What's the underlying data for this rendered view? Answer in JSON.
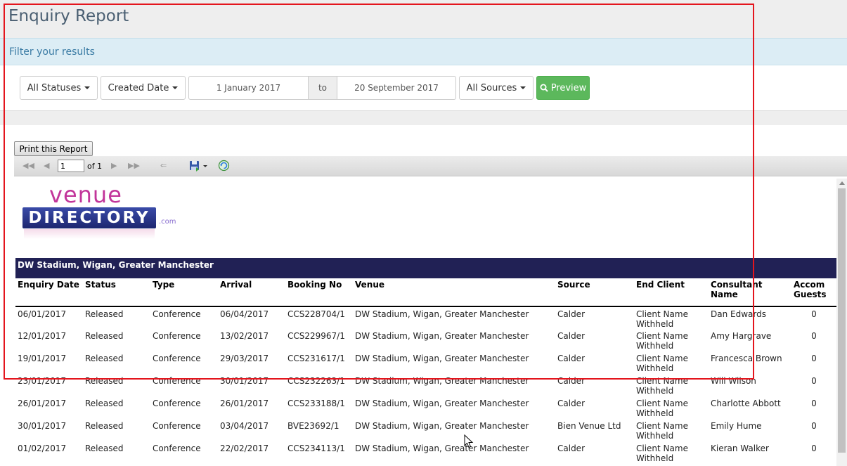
{
  "page": {
    "title": "Enquiry Report"
  },
  "filter": {
    "heading": "Filter your results",
    "status_label": "All Statuses",
    "date_type_label": "Created Date",
    "date_from": "1 January 2017",
    "date_to_label": "to",
    "date_to": "20 September 2017",
    "sources_label": "All Sources",
    "preview_label": "Preview"
  },
  "report_viewer": {
    "print_label": "Print this Report",
    "page_number": "1",
    "page_of": "of 1"
  },
  "logo": {
    "word1": "venue",
    "word2": "DIRECTORY",
    "suffix": ".com"
  },
  "report": {
    "group_title": "DW Stadium, Wigan, Greater Manchester",
    "columns": [
      "Enquiry Date",
      "Status",
      "Type",
      "Arrival",
      "Booking No",
      "Venue",
      "Source",
      "End Client",
      "Consultant Name",
      "Accom Guests"
    ],
    "rows": [
      [
        "06/01/2017",
        "Released",
        "Conference",
        "06/04/2017",
        "CCS228704/1",
        "DW Stadium, Wigan, Greater Manchester",
        "Calder",
        "Client Name Withheld",
        "Dan Edwards",
        "0"
      ],
      [
        "12/01/2017",
        "Released",
        "Conference",
        "13/02/2017",
        "CCS229967/1",
        "DW Stadium, Wigan, Greater Manchester",
        "Calder",
        "Client Name Withheld",
        "Amy Hargrave",
        "0"
      ],
      [
        "19/01/2017",
        "Released",
        "Conference",
        "29/03/2017",
        "CCS231617/1",
        "DW Stadium, Wigan, Greater Manchester",
        "Calder",
        "Client Name Withheld",
        "Francesca Brown",
        "0"
      ],
      [
        "23/01/2017",
        "Released",
        "Conference",
        "30/01/2017",
        "CCS232263/1",
        "DW Stadium, Wigan, Greater Manchester",
        "Calder",
        "Client Name Withheld",
        "Will Wilson",
        "0"
      ],
      [
        "26/01/2017",
        "Released",
        "Conference",
        "26/01/2017",
        "CCS233188/1",
        "DW Stadium, Wigan, Greater Manchester",
        "Calder",
        "Client Name Withheld",
        "Charlotte Abbott",
        "0"
      ],
      [
        "30/01/2017",
        "Released",
        "Conference",
        "03/04/2017",
        "BVE23692/1",
        "DW Stadium, Wigan, Greater Manchester",
        "Bien Venue Ltd",
        "Client Name Withheld",
        "Emily Hume",
        "0"
      ],
      [
        "01/02/2017",
        "Released",
        "Conference",
        "22/02/2017",
        "CCS234113/1",
        "DW Stadium, Wigan, Greater Manchester",
        "Calder",
        "Client Name Withheld",
        "Kieran Walker",
        "0"
      ]
    ]
  },
  "colors": {
    "accent_green": "#5cb85c",
    "band_navy": "#212155",
    "highlight_red": "#e4151d"
  }
}
